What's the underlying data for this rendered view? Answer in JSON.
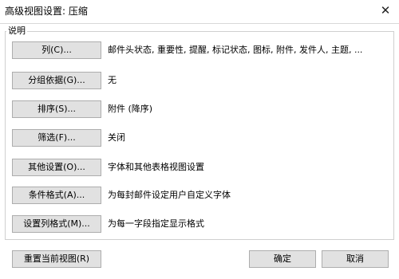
{
  "window": {
    "title": "高级视图设置: 压缩",
    "close_glyph": "✕"
  },
  "group": {
    "label": "说明"
  },
  "rows": [
    {
      "button": "列(C)...",
      "value": "邮件头状态, 重要性, 提醒, 标记状态, 图标, 附件, 发件人, 主题, ..."
    },
    {
      "button": "分组依据(G)...",
      "value": "无"
    },
    {
      "button": "排序(S)...",
      "value": "附件 (降序)"
    },
    {
      "button": "筛选(F)...",
      "value": "关闭"
    },
    {
      "button": "其他设置(O)...",
      "value": "字体和其他表格视图设置"
    },
    {
      "button": "条件格式(A)...",
      "value": "为每封邮件设定用户自定义字体"
    },
    {
      "button": "设置列格式(M)...",
      "value": "为每一字段指定显示格式"
    }
  ],
  "footer": {
    "reset_label": "重置当前视图(R)",
    "ok_label": "确定",
    "cancel_label": "取消"
  }
}
